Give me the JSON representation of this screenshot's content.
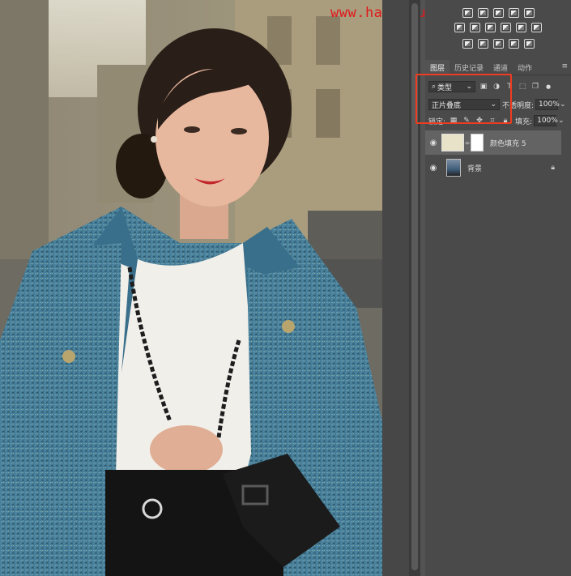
{
  "watermark": "www.hanyisuzhou.com",
  "panel": {
    "tabs": [
      {
        "label": "图层",
        "active": true
      },
      {
        "label": "历史记录",
        "active": false
      },
      {
        "label": "通道",
        "active": false
      },
      {
        "label": "动作",
        "active": false
      }
    ],
    "tab_menu_icon": "menu-icon",
    "filter_kind": "类型",
    "blend_mode": "正片叠底",
    "opacity_label": "不透明度:",
    "opacity_value": "100%",
    "lock_label": "锁定:",
    "fill_label": "填充:",
    "fill_value": "100%",
    "layers": [
      {
        "name": "颜色填充 5",
        "visible": true,
        "selected": true,
        "type": "fill"
      },
      {
        "name": "背景",
        "visible": true,
        "selected": false,
        "type": "background",
        "locked": true
      }
    ]
  },
  "colors": {
    "highlight": "#ef3b1f",
    "watermark": "#e2171b",
    "panel_bg": "#4a4a4a"
  }
}
